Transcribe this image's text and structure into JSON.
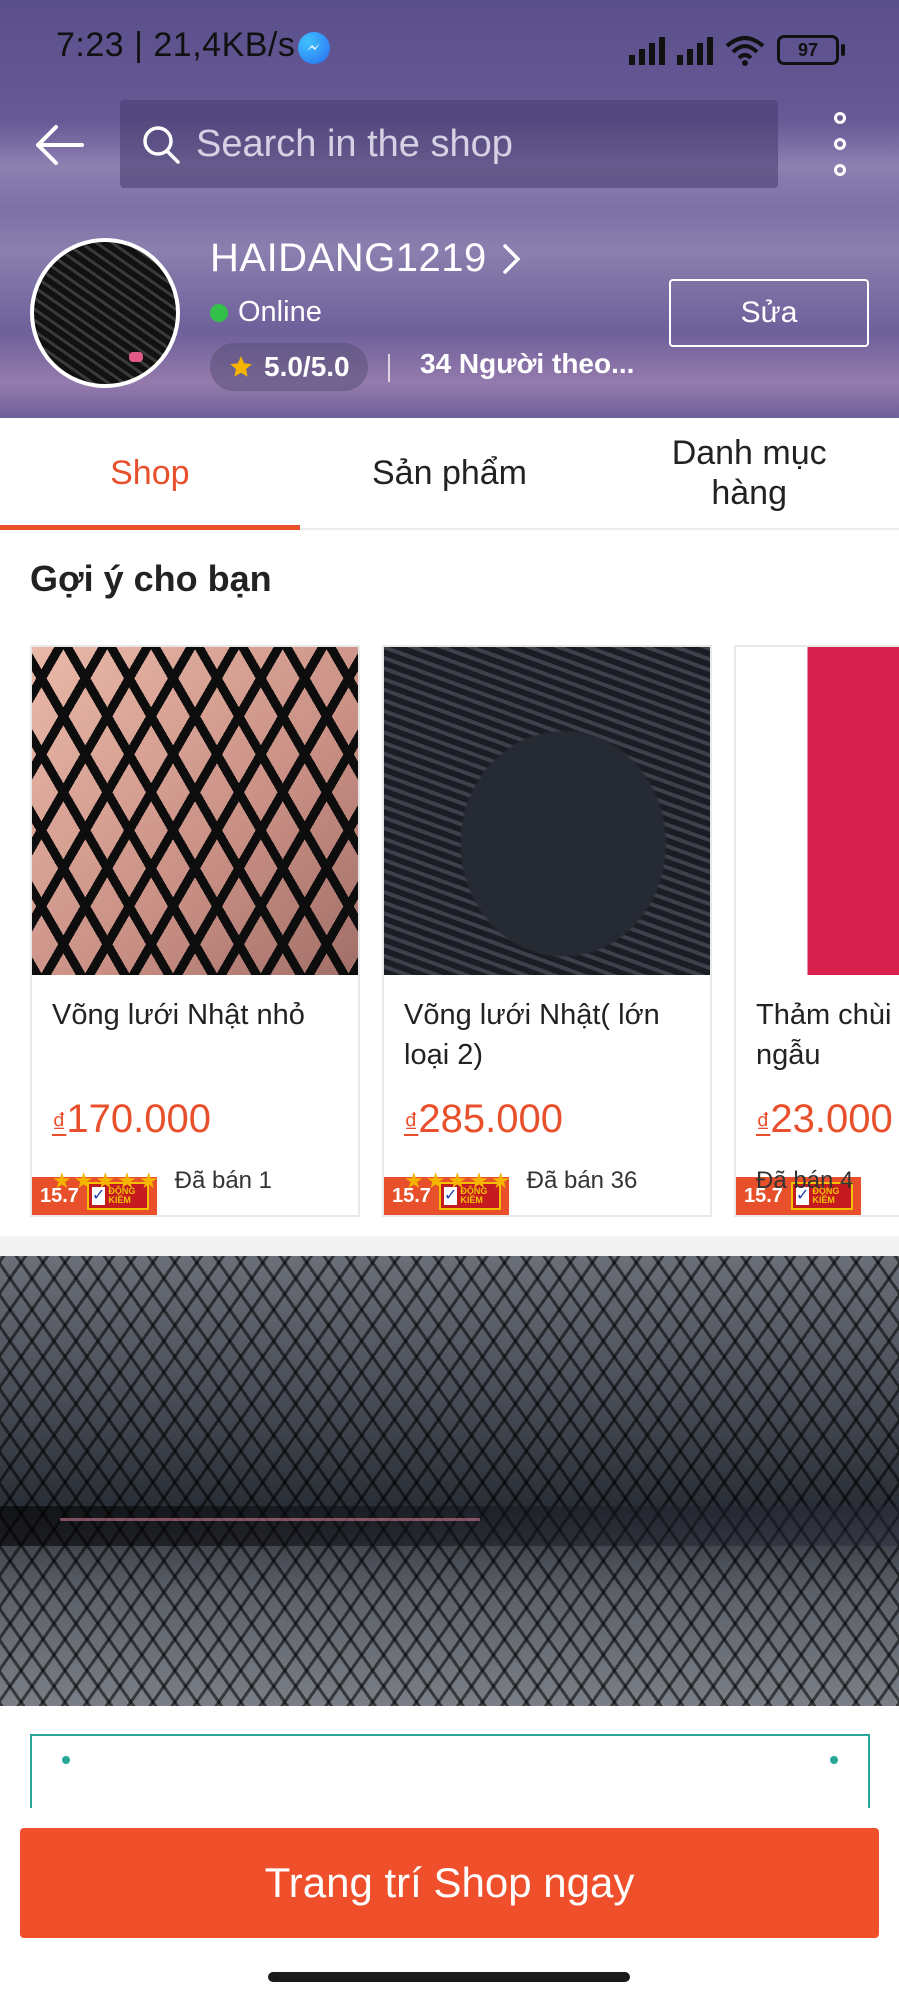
{
  "status_bar": {
    "time": "7:23 | 21,4KB/s",
    "battery": "97"
  },
  "header": {
    "search_placeholder": "Search in the shop",
    "shop_name": "HAIDANG1219",
    "online_status": "Online",
    "rating": "5.0/5.0",
    "followers": "34 Người theo...",
    "edit_label": "Sửa"
  },
  "tabs": [
    {
      "label": "Shop",
      "active": true
    },
    {
      "label": "Sản phẩm",
      "active": false
    },
    {
      "label": "Danh mục hàng",
      "active": false
    }
  ],
  "suggestions": {
    "title": "Gợi ý cho bạn",
    "products": [
      {
        "badge": "15.7",
        "badge_sub": "ĐỘNG KIỂM",
        "name": "Võng lưới Nhật nhỏ",
        "currency": "₫",
        "price": "170.000",
        "stars": 5,
        "sold": "Đã bán 1"
      },
      {
        "badge": "15.7",
        "badge_sub": "ĐỘNG KIỂM",
        "name": "Võng lưới Nhật( lớn loại 2)",
        "currency": "₫",
        "price": "285.000",
        "stars": 5,
        "sold": "Đã bán 36"
      },
      {
        "badge": "15.7",
        "badge_sub": "ĐỘNG KIỂM",
        "name": "Thảm chùi ( màu ngẫu",
        "currency": "₫",
        "price": "23.000",
        "stars": 0,
        "sold": "Đã bán 4"
      }
    ]
  },
  "cta": {
    "label": "Trang trí Shop ngay"
  },
  "colors": {
    "accent": "#ef4f2b",
    "active_tab": "#e8502c",
    "online": "#33c04a",
    "star": "#f6b400",
    "frame": "#2aa59a"
  }
}
